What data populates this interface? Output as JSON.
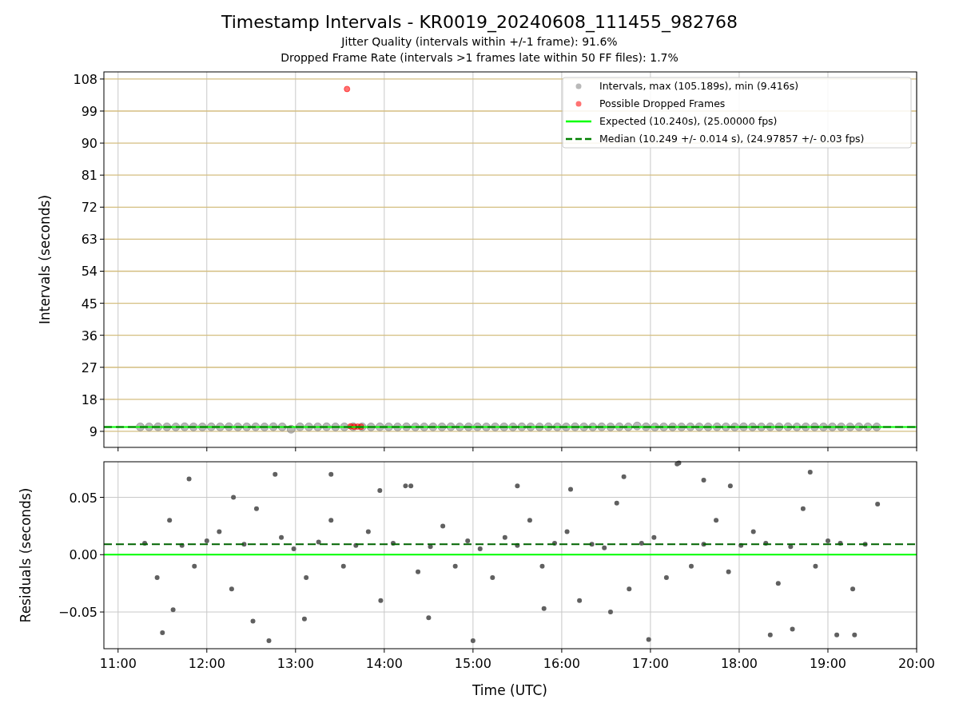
{
  "figure": {
    "title": "Timestamp Intervals - KR0019_20240608_111455_982768",
    "subtitles": [
      "Jitter Quality (intervals within +/-1 frame): 91.6%",
      "Dropped Frame Rate (intervals >1 frames late within 50 FF files): 1.7%"
    ]
  },
  "intervals_plot": {
    "chart_data": {
      "type": "scatter",
      "grid": true,
      "legend": true,
      "ylabel": "Intervals (seconds)",
      "xlim": [
        10.84,
        20
      ],
      "ylim": [
        4.5,
        110
      ],
      "yticks": [
        {
          "value": 9,
          "label": "9"
        },
        {
          "value": 18,
          "label": "18"
        },
        {
          "value": 27,
          "label": "27"
        },
        {
          "value": 36,
          "label": "36"
        },
        {
          "value": 45,
          "label": "45"
        },
        {
          "value": 54,
          "label": "54"
        },
        {
          "value": 63,
          "label": "63"
        },
        {
          "value": 72,
          "label": "72"
        },
        {
          "value": 81,
          "label": "81"
        },
        {
          "value": 90,
          "label": "90"
        },
        {
          "value": 99,
          "label": "99"
        },
        {
          "value": 108,
          "label": "108"
        }
      ],
      "series": [
        {
          "name": "Intervals, max (105.189s), min (9.416s)",
          "type": "scatter",
          "color": "#808080",
          "x": [
            11.25,
            11.35,
            11.45,
            11.55,
            11.65,
            11.75,
            11.85,
            11.95,
            12.05,
            12.15,
            12.25,
            12.35,
            12.45,
            12.55,
            12.65,
            12.75,
            12.85,
            12.95,
            13.05,
            13.15,
            13.25,
            13.35,
            13.45,
            13.55,
            13.65,
            13.75,
            13.85,
            13.95,
            14.05,
            14.15,
            14.25,
            14.35,
            14.45,
            14.55,
            14.65,
            14.75,
            14.85,
            14.95,
            15.05,
            15.15,
            15.25,
            15.35,
            15.45,
            15.55,
            15.65,
            15.75,
            15.85,
            15.95,
            16.05,
            16.15,
            16.25,
            16.35,
            16.45,
            16.55,
            16.65,
            16.75,
            16.85,
            16.95,
            17.05,
            17.15,
            17.25,
            17.35,
            17.45,
            17.55,
            17.65,
            17.75,
            17.85,
            17.95,
            18.05,
            18.15,
            18.25,
            18.35,
            18.45,
            18.55,
            18.65,
            18.75,
            18.85,
            18.95,
            19.05,
            19.15,
            19.25,
            19.35,
            19.45,
            19.55
          ],
          "values": [
            10.25,
            10.24,
            10.26,
            10.25,
            10.23,
            10.27,
            10.25,
            10.24,
            10.26,
            10.25,
            10.28,
            10.24,
            10.25,
            10.26,
            10.23,
            10.3,
            10.25,
            9.6,
            10.26,
            10.24,
            10.25,
            10.27,
            10.24,
            10.25,
            10.26,
            10.25,
            10.24,
            10.26,
            10.25,
            10.23,
            10.27,
            10.25,
            10.24,
            10.26,
            10.25,
            10.28,
            10.24,
            10.25,
            10.26,
            10.23,
            10.25,
            10.25,
            10.24,
            10.26,
            10.25,
            10.24,
            10.26,
            10.25,
            10.23,
            10.27,
            10.25,
            10.24,
            10.26,
            10.25,
            10.28,
            10.24,
            10.5,
            10.26,
            10.23,
            10.25,
            10.25,
            10.24,
            10.26,
            10.25,
            10.24,
            10.26,
            10.25,
            10.23,
            10.27,
            10.25,
            10.24,
            10.26,
            10.25,
            10.28,
            10.24,
            10.25,
            10.26,
            10.23,
            10.25,
            10.25,
            10.24,
            10.26,
            10.25,
            10.24
          ]
        },
        {
          "name": "Possible Dropped Frames",
          "type": "scatter",
          "color": "#ff0000",
          "x": [
            13.58,
            13.62,
            13.66,
            13.7,
            13.74
          ],
          "values": [
            105.19,
            10.4,
            10.3,
            10.35,
            10.3
          ]
        },
        {
          "name": "Expected (10.240s), (25.00000 fps)",
          "type": "line",
          "color": "#00ff00",
          "x": [
            10.84,
            20
          ],
          "values": [
            10.24,
            10.24
          ]
        },
        {
          "name": "Median (10.249 +/- 0.014 s), (24.97857 +/- 0.03 fps)",
          "type": "line",
          "line_style": "dashed",
          "color": "#008000",
          "x": [
            10.84,
            20
          ],
          "values": [
            10.249,
            10.249
          ]
        }
      ]
    }
  },
  "residuals_plot": {
    "chart_data": {
      "type": "scatter",
      "grid": true,
      "ylabel": "Residuals (seconds)",
      "xlabel": "Time (UTC)",
      "xlim": [
        10.84,
        20
      ],
      "ylim": [
        -0.082,
        0.081
      ],
      "xticks": [
        {
          "value": 11,
          "label": "11:00"
        },
        {
          "value": 12,
          "label": "12:00"
        },
        {
          "value": 13,
          "label": "13:00"
        },
        {
          "value": 14,
          "label": "14:00"
        },
        {
          "value": 15,
          "label": "15:00"
        },
        {
          "value": 16,
          "label": "16:00"
        },
        {
          "value": 17,
          "label": "17:00"
        },
        {
          "value": 18,
          "label": "18:00"
        },
        {
          "value": 19,
          "label": "19:00"
        },
        {
          "value": 20,
          "label": "20:00"
        }
      ],
      "yticks": [
        {
          "value": 0.05,
          "label": "0.05"
        },
        {
          "value": 0,
          "label": "0.00"
        },
        {
          "value": -0.05,
          "label": "−0.05"
        }
      ],
      "series": [
        {
          "type": "scatter",
          "color": "#606060",
          "x": [
            11.3,
            11.44,
            11.58,
            11.72,
            11.86,
            12.0,
            12.14,
            12.28,
            12.42,
            12.56,
            12.7,
            12.84,
            12.98,
            13.12,
            13.26,
            13.4,
            13.54,
            13.68,
            13.82,
            13.96,
            14.1,
            14.24,
            14.38,
            14.52,
            14.66,
            14.8,
            14.94,
            15.08,
            15.22,
            15.36,
            15.5,
            15.64,
            15.78,
            15.92,
            16.06,
            16.2,
            16.34,
            16.48,
            16.62,
            16.76,
            16.9,
            17.04,
            17.18,
            17.32,
            17.46,
            17.6,
            17.74,
            17.88,
            18.02,
            18.16,
            18.3,
            18.44,
            18.58,
            18.72,
            18.86,
            19.0,
            19.14,
            19.28,
            19.42,
            19.56,
            11.5,
            11.8,
            12.3,
            12.77,
            13.4,
            13.95,
            14.5,
            15.0,
            15.5,
            16.1,
            16.55,
            16.98,
            17.3,
            17.9,
            18.35,
            18.8,
            19.3,
            11.62,
            12.52,
            13.1,
            14.3,
            15.8,
            16.7,
            17.6,
            18.6,
            19.1
          ],
          "values": [
            0.01,
            -0.02,
            0.03,
            0.008,
            -0.01,
            0.012,
            0.02,
            -0.03,
            0.009,
            0.04,
            -0.075,
            0.015,
            0.005,
            -0.02,
            0.011,
            0.03,
            -0.01,
            0.008,
            0.02,
            -0.04,
            0.01,
            0.06,
            -0.015,
            0.007,
            0.025,
            -0.01,
            0.012,
            0.005,
            -0.02,
            0.015,
            0.008,
            0.03,
            -0.01,
            0.01,
            0.02,
            -0.04,
            0.009,
            0.006,
            0.045,
            -0.03,
            0.01,
            0.015,
            -0.02,
            0.08,
            -0.01,
            0.009,
            0.03,
            -0.015,
            0.008,
            0.02,
            0.01,
            -0.025,
            0.007,
            0.04,
            -0.01,
            0.012,
            0.01,
            -0.03,
            0.009,
            0.044,
            -0.068,
            0.066,
            0.05,
            0.07,
            0.07,
            0.056,
            -0.055,
            -0.075,
            0.06,
            0.057,
            -0.05,
            -0.074,
            0.079,
            0.06,
            -0.07,
            0.072,
            -0.07,
            -0.048,
            -0.058,
            -0.056,
            0.06,
            -0.047,
            0.068,
            0.065,
            -0.065,
            -0.07
          ]
        },
        {
          "type": "line",
          "color": "#00ff00",
          "x": [
            10.84,
            20
          ],
          "values": [
            0,
            0
          ]
        },
        {
          "type": "line",
          "line_style": "dashed",
          "color": "#006400",
          "x": [
            10.84,
            20
          ],
          "values": [
            0.009,
            0.009
          ]
        }
      ]
    }
  }
}
